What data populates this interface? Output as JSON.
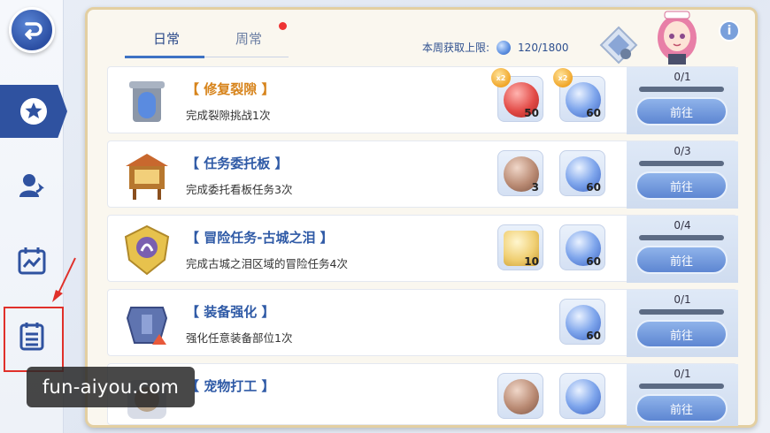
{
  "tabs": [
    {
      "label": "日常",
      "active": true
    },
    {
      "label": "周常",
      "active": false
    }
  ],
  "weekly_limit": {
    "label": "本周获取上限:",
    "value": "120/1800"
  },
  "info_label": "i",
  "tasks": [
    {
      "title": "【 修复裂隙 】",
      "desc": "完成裂隙挑战1次",
      "title_color": "gold",
      "icon": "portal-gate-icon",
      "rewards": [
        {
          "icon": "red-coin-icon",
          "qty": "50",
          "double": true
        },
        {
          "icon": "blue-gem-icon",
          "qty": "60",
          "double": true
        }
      ],
      "progress": "0/1",
      "button": "前往"
    },
    {
      "title": "【 任务委托板 】",
      "desc": "完成委托看板任务3次",
      "title_color": "blue",
      "icon": "notice-board-icon",
      "rewards": [
        {
          "icon": "bronze-coin-icon",
          "qty": "3",
          "double": false
        },
        {
          "icon": "blue-gem-icon",
          "qty": "60",
          "double": false
        }
      ],
      "progress": "0/3",
      "button": "前往"
    },
    {
      "title": "【 冒险任务-古城之泪 】",
      "desc": "完成古城之泪区域的冒险任务4次",
      "title_color": "blue",
      "icon": "crest-emblem-icon",
      "rewards": [
        {
          "icon": "gold-star-icon",
          "qty": "10",
          "double": false
        },
        {
          "icon": "blue-gem-icon",
          "qty": "60",
          "double": false
        }
      ],
      "progress": "0/4",
      "button": "前往"
    },
    {
      "title": "【 装备强化 】",
      "desc": "强化任意装备部位1次",
      "title_color": "blue",
      "icon": "armor-upgrade-icon",
      "rewards": [
        {
          "icon": "blue-gem-icon",
          "qty": "60",
          "double": false
        }
      ],
      "progress": "0/1",
      "button": "前往"
    },
    {
      "title": "【 宠物打工 】",
      "desc": "",
      "title_color": "blue",
      "icon": "pet-work-icon",
      "rewards": [
        {
          "icon": "bronze-coin-icon",
          "qty": "",
          "double": false
        },
        {
          "icon": "blue-gem-icon",
          "qty": "",
          "double": false
        }
      ],
      "progress": "0/1",
      "button": "前往"
    }
  ],
  "watermark": "fun-aiyou.com",
  "colors": {
    "accent": "#2f52a0",
    "gold_title": "#d7841c",
    "blue_title": "#2f5aa6",
    "highlight_box": "#e0302a"
  }
}
